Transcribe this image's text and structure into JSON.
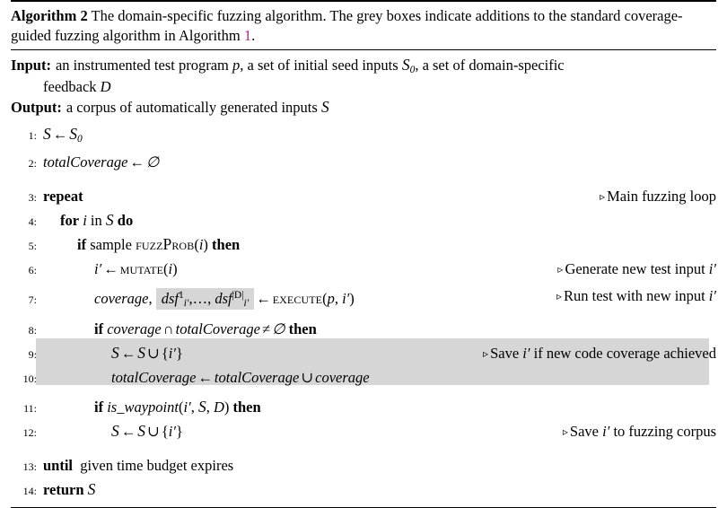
{
  "caption": {
    "label": "Algorithm 2",
    "text_before": " The domain-specific fuzzing algorithm. The grey boxes indicate additions to the standard coverage-guided fuzzing algorithm in Algorithm ",
    "ref": "1",
    "text_after": "."
  },
  "io": {
    "input_key": "Input:",
    "input_text_a": "an instrumented test program ",
    "input_p": "p",
    "input_text_b": ", a set of initial seed inputs ",
    "input_S": "S",
    "input_S_sub": "0",
    "input_text_c": ", a set of domain-specific",
    "input_text_d": "feedback ",
    "input_D": "D",
    "output_key": "Output:",
    "output_text": "a corpus of automatically generated inputs ",
    "output_S": "S"
  },
  "lines": [
    {
      "num": "1",
      "code": "S ← S0",
      "comment": ""
    },
    {
      "num": "2",
      "code": "totalCoverage ← ∅",
      "comment": ""
    },
    {
      "num": "3",
      "code": "repeat",
      "comment": "Main fuzzing loop"
    },
    {
      "num": "4",
      "code": "for i in S do",
      "comment": ""
    },
    {
      "num": "5",
      "code": "if sample fuzzProb(i) then",
      "comment": ""
    },
    {
      "num": "6",
      "code": "i′ ← mutate(i)",
      "comment": "Generate new test input i′"
    },
    {
      "num": "7",
      "code": "coverage, dsf¹i′, …, dsf|D|i′ ← execute(p, i′)",
      "comment": "Run test with new input i′"
    },
    {
      "num": "8",
      "code": "if coverage ∩ totalCoverage ≠ ∅ then",
      "comment": ""
    },
    {
      "num": "9",
      "code": "S ← S ∪ {i′}",
      "comment": "Save i′ if new code coverage achieved"
    },
    {
      "num": "10",
      "code": "totalCoverage ← totalCoverage ∪ coverage",
      "comment": ""
    },
    {
      "num": "11",
      "code": "if is_waypoint(i′, S, D) then",
      "comment": ""
    },
    {
      "num": "12",
      "code": "S ← S ∪ {i′}",
      "comment": "Save i′ to fuzzing corpus"
    },
    {
      "num": "13",
      "code": "until given time budget expires",
      "comment": ""
    },
    {
      "num": "14",
      "code": "return S",
      "comment": ""
    }
  ],
  "tokens": {
    "repeat": "repeat",
    "for": "for",
    "in": "in",
    "do": "do",
    "if": "if",
    "then": "then",
    "until": "until",
    "return": "return",
    "sample": "sample",
    "fuzzProb": "fuzzProb",
    "mutate": "mutate",
    "execute": "execute",
    "is_waypoint": "is_waypoint",
    "totalCoverage": "totalCoverage",
    "coverage": "coverage",
    "dsf": "dsf",
    "given_time_budget": "given time budget expires",
    "i": "i",
    "i_prime": "i′",
    "p": "p",
    "D": "D",
    "S": "S",
    "S_cal": "S",
    "zero": "0",
    "one": "1",
    "absD": "|D|",
    "arrow": "←",
    "cup": "∪",
    "cap": "∩",
    "neq": "≠",
    "emptyset": "∅",
    "lbrace": "{",
    "rbrace": "}",
    "comma": ",",
    "lparen": "(",
    "rparen": ")",
    "ellipsis": "…",
    "triangle": "▹"
  },
  "comments": {
    "main_loop": "Main fuzzing loop",
    "generate": "Generate new test input ",
    "run_test": "Run test with new input ",
    "save_coverage": "Save ",
    "save_coverage_tail": " if new code coverage achieved",
    "save_corpus": "Save ",
    "save_corpus_tail": " to fuzzing corpus"
  },
  "colors": {
    "shade": "#d6d6d6",
    "link": "#b0268f",
    "text": "#000000"
  }
}
